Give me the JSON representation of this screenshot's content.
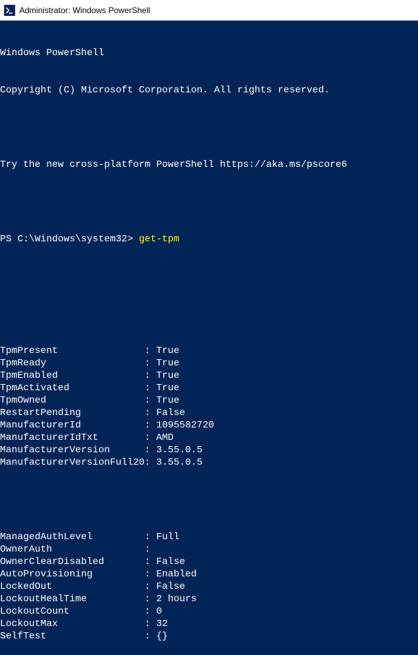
{
  "window": {
    "title": "Administrator: Windows PowerShell"
  },
  "header": {
    "line1": "Windows PowerShell",
    "line2": "Copyright (C) Microsoft Corporation. All rights reserved.",
    "tryline": "Try the new cross-platform PowerShell https://aka.ms/pscore6"
  },
  "prompt": {
    "path": "PS C:\\Windows\\system32> ",
    "command": "get-tpm"
  },
  "output": {
    "rows": [
      {
        "key": "TpmPresent",
        "value": "True"
      },
      {
        "key": "TpmReady",
        "value": "True"
      },
      {
        "key": "TpmEnabled",
        "value": "True"
      },
      {
        "key": "TpmActivated",
        "value": "True"
      },
      {
        "key": "TpmOwned",
        "value": "True"
      },
      {
        "key": "RestartPending",
        "value": "False"
      },
      {
        "key": "ManufacturerId",
        "value": "1095582720"
      },
      {
        "key": "ManufacturerIdTxt",
        "value": "AMD"
      },
      {
        "key": "ManufacturerVersion",
        "value": "3.55.0.5"
      },
      {
        "key": "ManufacturerVersionFull20",
        "value": "3.55.0.5"
      }
    ],
    "rows2": [
      {
        "key": "ManagedAuthLevel",
        "value": "Full"
      },
      {
        "key": "OwnerAuth",
        "value": ""
      },
      {
        "key": "OwnerClearDisabled",
        "value": "False"
      },
      {
        "key": "AutoProvisioning",
        "value": "Enabled"
      },
      {
        "key": "LockedOut",
        "value": "False"
      },
      {
        "key": "LockoutHealTime",
        "value": "2 hours"
      },
      {
        "key": "LockoutCount",
        "value": "0"
      },
      {
        "key": "LockoutMax",
        "value": "32"
      },
      {
        "key": "SelfTest",
        "value": "{}"
      }
    ]
  },
  "separator": ": "
}
